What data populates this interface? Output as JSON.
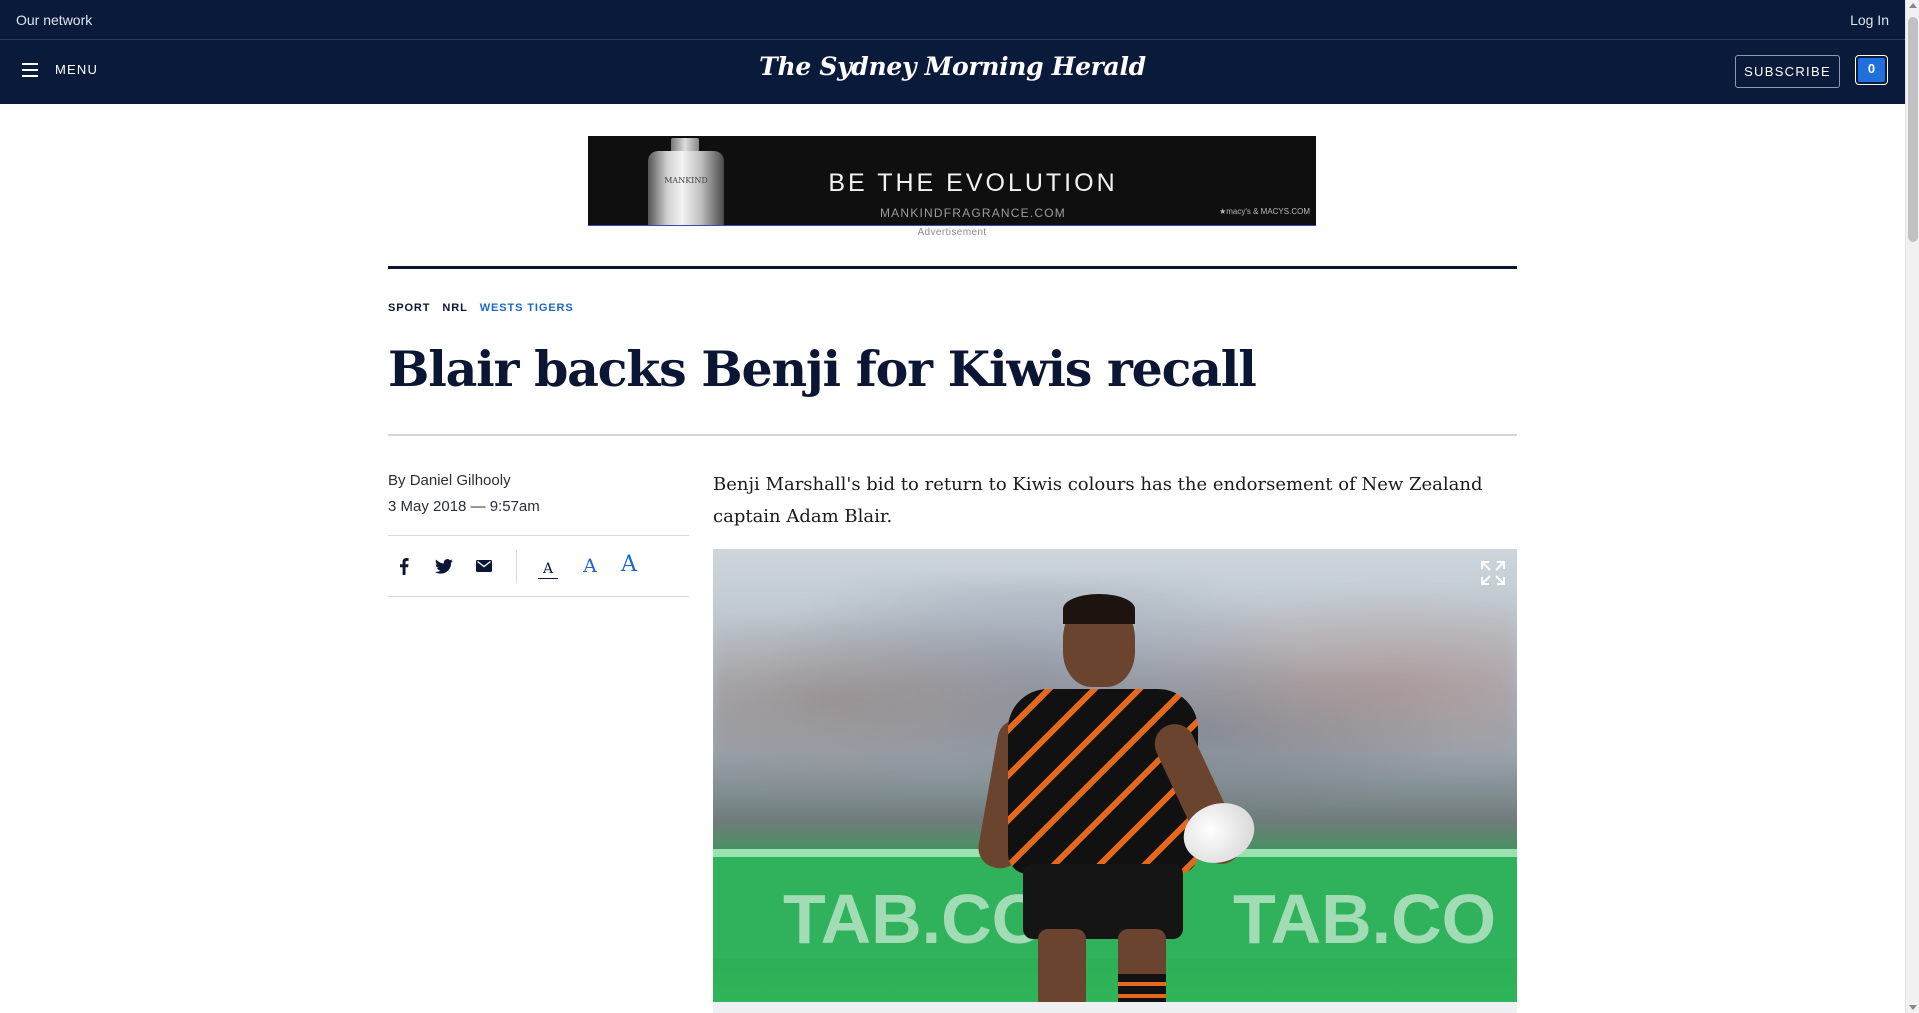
{
  "network_bar": {
    "left_label": "Our network",
    "right_label": "Log In"
  },
  "header": {
    "menu_label": "MENU",
    "masthead": "The Sydney Morning Herald",
    "subscribe_label": "SUBSCRIBE",
    "count_badge": "0"
  },
  "ad": {
    "headline": "BE THE EVOLUTION",
    "url": "MANKINDFRAGRANCE.COM",
    "retailer": "★macy's & MACYS.COM",
    "bottle_brand": "MANKIND",
    "label": "Advertisement"
  },
  "article": {
    "breadcrumb": [
      "SPORT",
      "NRL",
      "WESTS TIGERS"
    ],
    "headline": "Blair backs Benji for Kiwis recall",
    "byline_prefix": "By ",
    "author": "Daniel Gilhooly",
    "dateline": "3 May 2018 — 9:57am",
    "lede": "Benji Marshall's bid to return to Kiwis colours has the endorsement of New Zealand captain Adam Blair.",
    "font_sizes": [
      "A",
      "A",
      "A"
    ]
  },
  "hero": {
    "signage_text": [
      "TAB.CO",
      "TAB.CO"
    ]
  },
  "colors": {
    "navy": "#0a1a3a",
    "accent_blue": "#1d67c9",
    "badge_blue": "#1f6fdd"
  },
  "icons": [
    "menu-icon",
    "facebook-icon",
    "twitter-icon",
    "email-icon",
    "expand-icon"
  ]
}
